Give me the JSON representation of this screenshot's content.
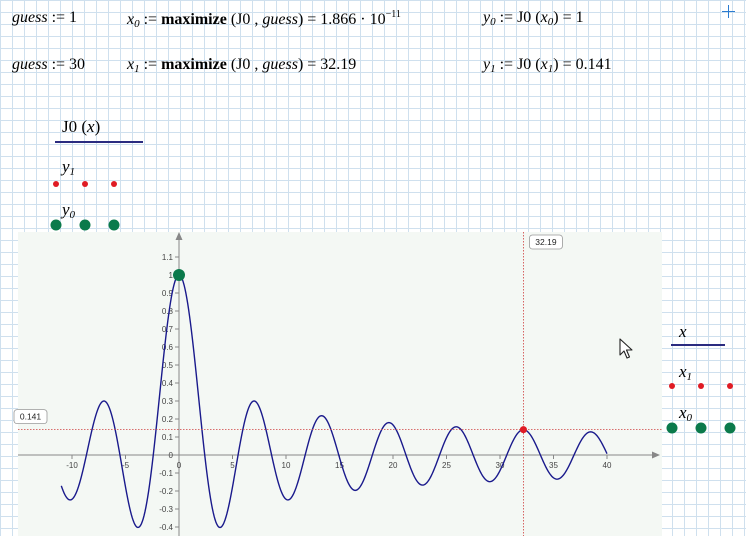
{
  "equations": {
    "row1": {
      "guess_name": "guess",
      "guess_assign": " := 1",
      "x0_name": "x",
      "x0_sub": "0",
      "x0_assign": " := ",
      "x0_func": "maximize",
      "x0_args_open": " (J0 , ",
      "x0_args_guess": "guess",
      "x0_args_close": ") = 1.866 · 10",
      "x0_exp": "−11",
      "y0_name": "y",
      "y0_sub": "0",
      "y0_expr": " := J0 (",
      "y0_arg": "x",
      "y0_arg_sub": "0",
      "y0_result": ") = 1"
    },
    "row2": {
      "guess_name": "guess",
      "guess_assign": " := 30",
      "x1_name": "x",
      "x1_sub": "1",
      "x1_assign": " := ",
      "x1_func": "maximize",
      "x1_args_open": " (J0 , ",
      "x1_args_guess": "guess",
      "x1_args_close": ") = 32.19",
      "y1_name": "y",
      "y1_sub": "1",
      "y1_expr": " := J0 (",
      "y1_arg": "x",
      "y1_arg_sub": "1",
      "y1_result": ") = 0.141"
    }
  },
  "plot": {
    "y_axis_title_fn": "J0 (",
    "y_axis_title_arg": "x",
    "y_axis_title_close": ")",
    "y_legend": [
      {
        "name": "y",
        "sub": "1",
        "style": "red-dots"
      },
      {
        "name": "y",
        "sub": "0",
        "style": "green-dots"
      }
    ],
    "x_axis_title": "x",
    "x_legend": [
      {
        "name": "x",
        "sub": "1",
        "style": "red-dots"
      },
      {
        "name": "x",
        "sub": "0",
        "style": "green-dots"
      }
    ],
    "x_marker_label": "32.19",
    "y_marker_label": "0.141",
    "colors": {
      "curve": "#1a1a8c",
      "red": "#e01b24",
      "green": "#0b7a4b",
      "marker_line": "#d04040"
    }
  },
  "chart_data": {
    "type": "line",
    "function": "J0(x)",
    "x_range": [
      -11,
      40
    ],
    "xlim": [
      -15,
      44
    ],
    "ylim": [
      -0.42,
      1.2
    ],
    "x_ticks": [
      "-10",
      "-5",
      "0",
      "5",
      "10",
      "15",
      "20",
      "25",
      "30",
      "35",
      "40"
    ],
    "y_ticks": [
      "1.1",
      "1",
      "0.9",
      "0.8",
      "0.7",
      "0.6",
      "0.5",
      "0.4",
      "0.3",
      "0.2",
      "0.1",
      "0",
      "-0.1",
      "-0.2",
      "-0.3",
      "-0.4"
    ],
    "points": [
      {
        "name": "x0,y0",
        "x": 0,
        "y": 1,
        "color": "green"
      },
      {
        "name": "x1,y1",
        "x": 32.19,
        "y": 0.141,
        "color": "red"
      }
    ],
    "marker_lines": {
      "x": 32.19,
      "y": 0.141
    }
  }
}
